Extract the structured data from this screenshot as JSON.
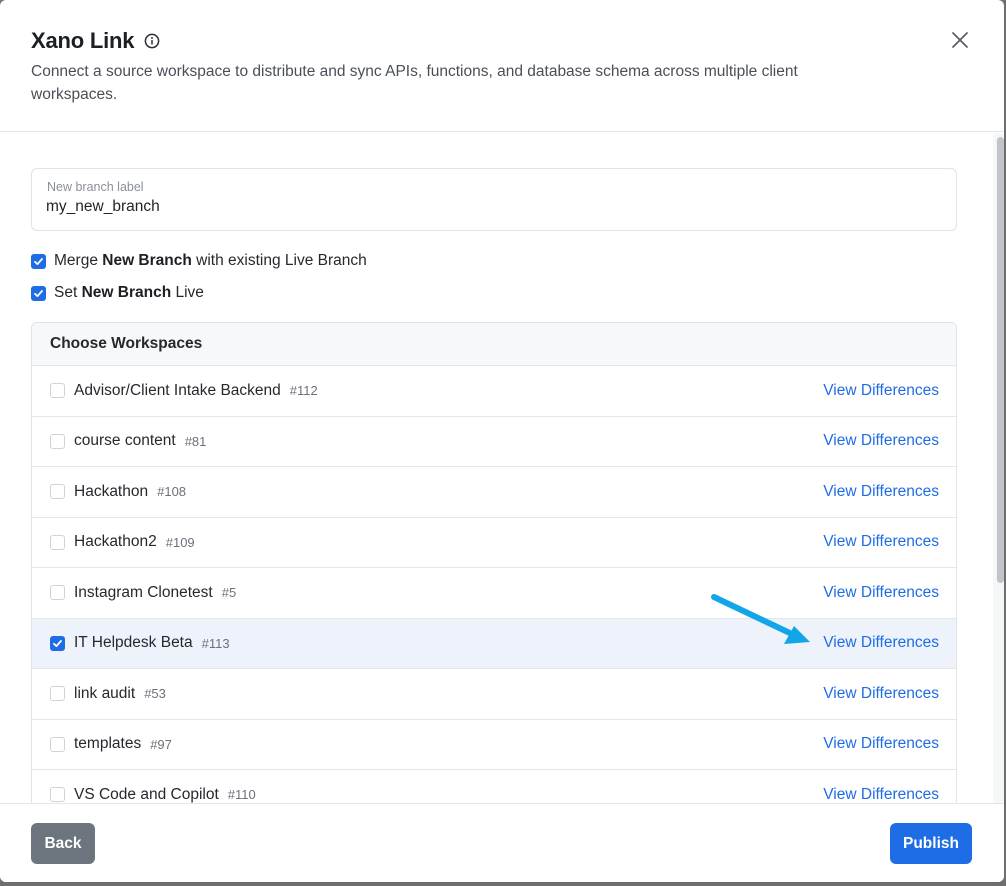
{
  "dialog": {
    "title": "Xano Link",
    "subtitle": "Connect a source workspace to distribute and sync APIs, functions, and database schema across multiple client workspaces."
  },
  "branch_field": {
    "label": "New branch label",
    "value": "my_new_branch"
  },
  "options": [
    {
      "checked": true,
      "prefix": "Merge ",
      "bold": "New Branch",
      "suffix": " with existing Live Branch"
    },
    {
      "checked": true,
      "prefix": "Set ",
      "bold": "New Branch",
      "suffix": " Live"
    }
  ],
  "workspaces": {
    "heading": "Choose Workspaces",
    "link_label": "View Differences",
    "items": [
      {
        "name": "Advisor/Client Intake Backend",
        "id": "#112",
        "checked": false
      },
      {
        "name": "course content",
        "id": "#81",
        "checked": false
      },
      {
        "name": "Hackathon",
        "id": "#108",
        "checked": false
      },
      {
        "name": "Hackathon2",
        "id": "#109",
        "checked": false
      },
      {
        "name": "Instagram Clonetest",
        "id": "#5",
        "checked": false
      },
      {
        "name": "IT Helpdesk Beta",
        "id": "#113",
        "checked": true
      },
      {
        "name": "link audit",
        "id": "#53",
        "checked": false
      },
      {
        "name": "templates",
        "id": "#97",
        "checked": false
      },
      {
        "name": "VS Code and Copilot",
        "id": "#110",
        "checked": false
      }
    ]
  },
  "footer": {
    "back_label": "Back",
    "publish_label": "Publish"
  },
  "colors": {
    "accent": "#1e6ce6",
    "secondary_button": "#6c757d",
    "annotation_arrow": "#12a6e8",
    "selected_row": "#eef3fb"
  }
}
